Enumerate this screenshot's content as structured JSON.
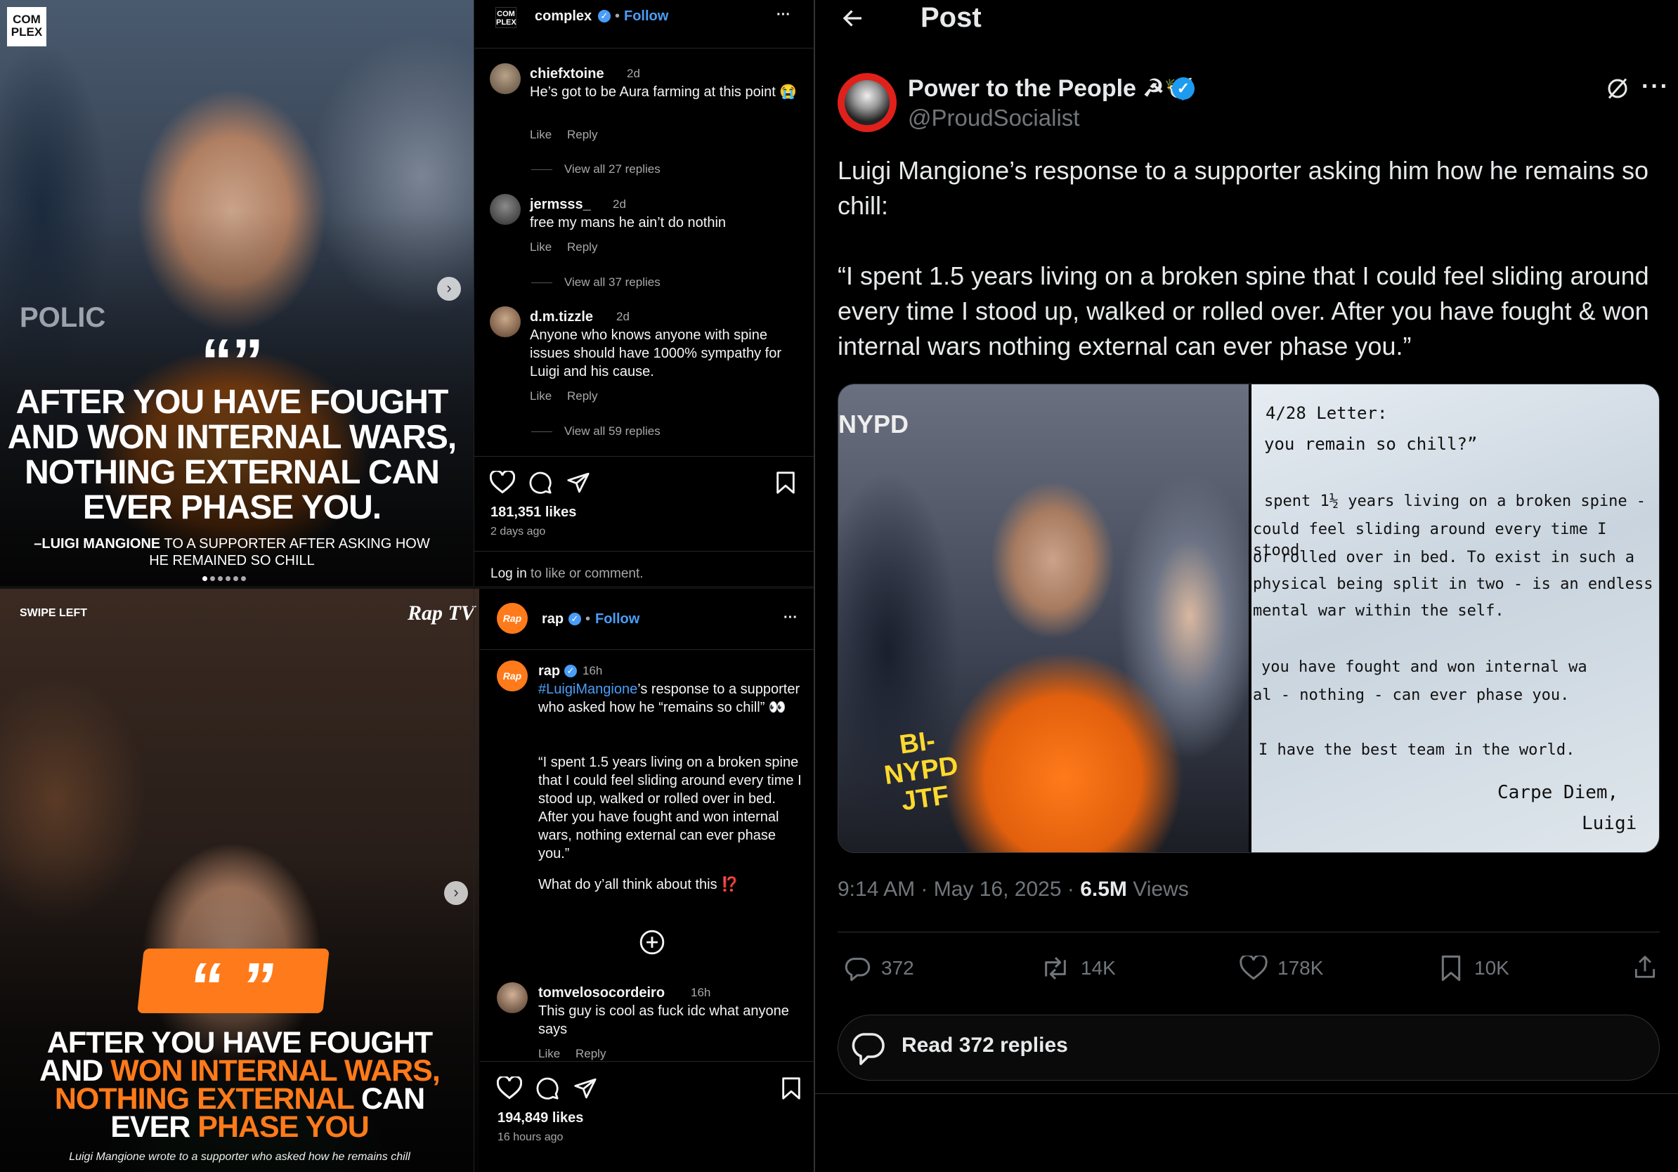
{
  "complex_post": {
    "logo_text": "COM PLEX",
    "quote_mark": "“”",
    "headline_lines": [
      "AFTER YOU HAVE FOUGHT",
      "AND WON INTERNAL WARS,",
      "NOTHING EXTERNAL CAN",
      "EVER PHASE YOU."
    ],
    "credit_bold": "–LUIGI MANGIONE",
    "credit_rest_1": " TO A SUPPORTER AFTER ASKING HOW",
    "credit_rest_2": "HE REMAINED SO CHILL",
    "header": {
      "username": "complex",
      "dot": "•",
      "follow": "Follow",
      "more": "···"
    },
    "comments": [
      {
        "user": "chiefxtoine",
        "time": "2d",
        "text": "He’s got to be Aura farming at this point 😭",
        "like": "Like",
        "reply": "Reply",
        "view_replies": "View all 27 replies"
      },
      {
        "user": "jermsss_",
        "time": "2d",
        "text": "free my mans he ain’t do nothin",
        "like": "Like",
        "reply": "Reply",
        "view_replies": "View all 37 replies"
      },
      {
        "user": "d.m.tizzle",
        "time": "2d",
        "text": "Anyone who knows anyone with spine issues should have 1000% sympathy for Luigi and his cause.",
        "like": "Like",
        "reply": "Reply",
        "view_replies": "View all 59 replies"
      }
    ],
    "likes": "181,351 likes",
    "time_ago": "2 days ago",
    "login_bold": "Log in",
    "login_rest": " to like or comment."
  },
  "rap_post": {
    "swipe_label": "SWIPE LEFT",
    "brand": "Rap TV",
    "quote_mark": "“ ”",
    "headline": {
      "l1": "AFTER YOU HAVE FOUGHT",
      "l2a": "AND ",
      "l2b": "WON INTERNAL WARS,",
      "l3a": "NOTHING EXTERNAL",
      "l3b": " CAN",
      "l4a": "EVER ",
      "l4b": "PHASE YOU"
    },
    "caption": "Luigi Mangione wrote to a supporter who asked how he remains chill",
    "header": {
      "username": "rap",
      "dot": "•",
      "follow": "Follow",
      "more": "···"
    },
    "caption_user": "rap",
    "caption_time": "16h",
    "caption_hashtag": "#LuigiMangione",
    "caption_rest": "’s response to a supporter who asked how he “remains so chill” 👀",
    "quote": "“I spent 1.5 years living on a broken spine that I could feel sliding around every time I stood up, walked or rolled over in bed. After you have fought and won internal wars, nothing external can ever phase you.”",
    "question": "What do y’all think about this ⁉️",
    "comment": {
      "user": "tomvelosocordeiro",
      "time": "16h",
      "text": "This guy is cool as fuck idc what anyone says",
      "like": "Like",
      "reply": "Reply"
    },
    "likes": "194,849 likes",
    "time_ago": "16 hours ago"
  },
  "x_post": {
    "page_title": "Post",
    "display_name": "Power to the People ☭🕊️",
    "handle": "@ProudSocialist",
    "text_line1": "Luigi Mangione’s response to a supporter asking him how he remains so chill:",
    "quote": "“I spent 1.5 years living on a broken spine that I could feel sliding around every time I stood up, walked or rolled over. After you have fought & won internal wars nothing external can ever phase you.”",
    "photo_tags": {
      "nypd": "NYPD",
      "jacket": "BI-NYPD",
      "jtf": "JTF"
    },
    "letter_lines": [
      "4/28 Letter:",
      "you remain so chill?”",
      "spent 1½ years living on a broken spine -",
      "could feel sliding around every time I stood",
      "or rolled over in bed. To exist in such a",
      "physical being split in two - is an endless",
      "mental war within the self.",
      "you have fought and won internal wa",
      "al - nothing - can ever phase you.",
      "I have the best team in the world.",
      "Carpe Diem,",
      "Luigi"
    ],
    "timestamp": "9:14 AM · May 16, 2025 · ",
    "views_count": "6.5M",
    "views_label": " Views",
    "stats": {
      "replies": "372",
      "reposts": "14K",
      "likes": "178K",
      "bookmarks": "10K"
    },
    "read_replies": "Read 372 replies",
    "colors": {
      "x_blue": "#1d9bf0",
      "ig_blue": "#4a9df8",
      "orange": "#ff7a1a",
      "avatar_red": "#e0211b"
    }
  }
}
